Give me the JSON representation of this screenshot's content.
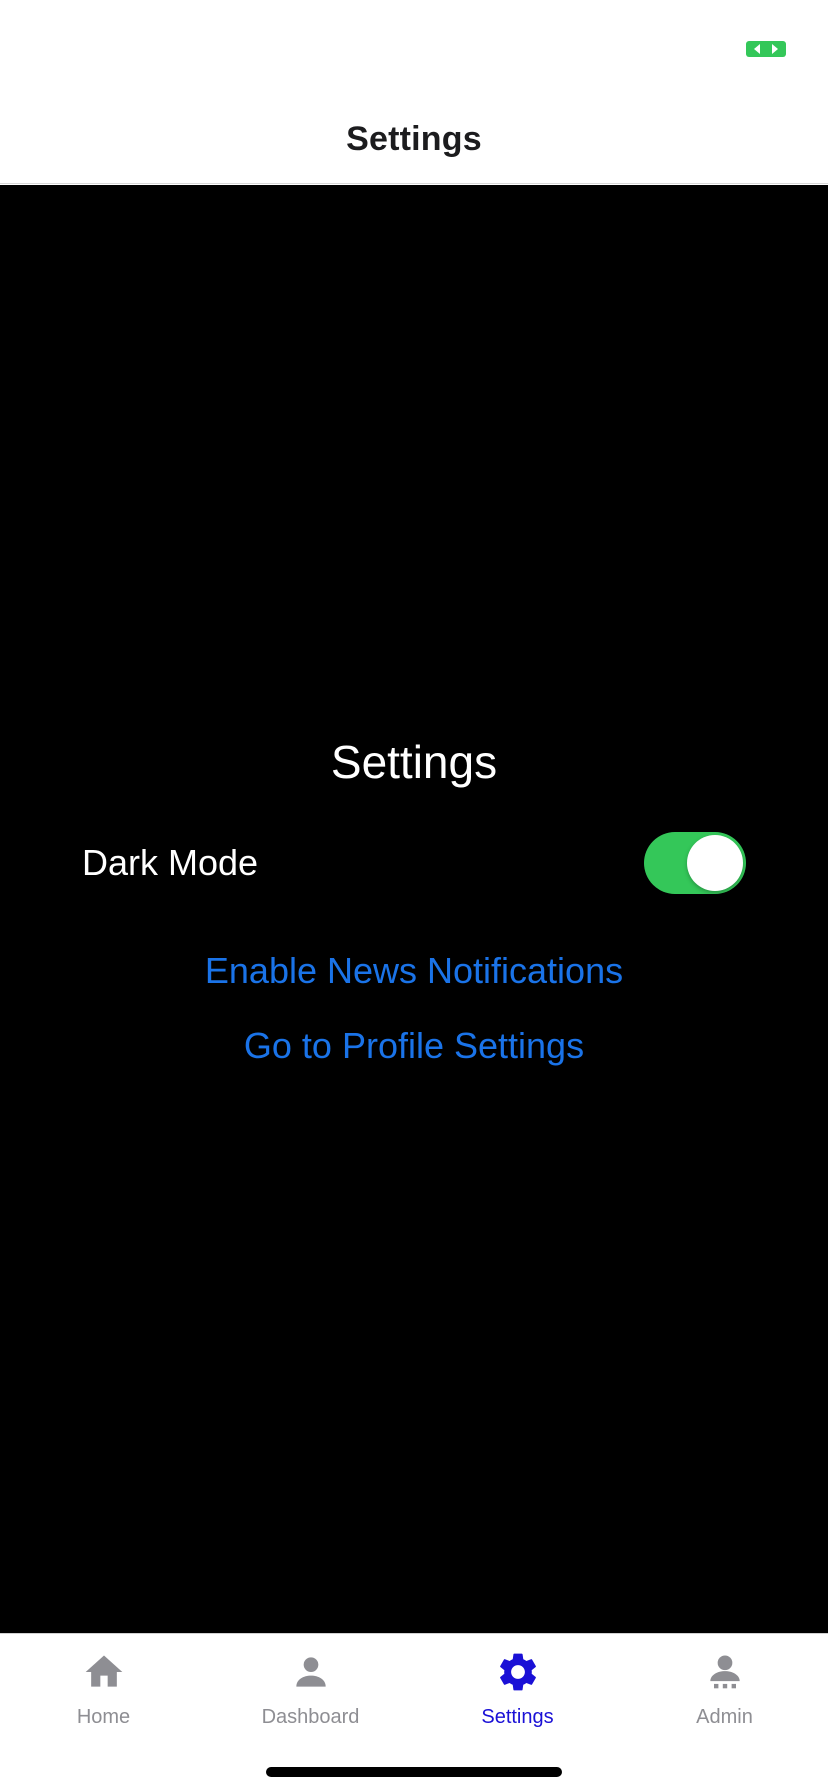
{
  "colors": {
    "accent": "#1a10d6",
    "link": "#1a73e8",
    "toggle_on": "#34c759",
    "status_indicator": "#34c759",
    "tab_inactive": "#8e8e93",
    "content_background": "#000000"
  },
  "header": {
    "title": "Settings"
  },
  "screen": {
    "title": "Settings",
    "dark_mode": {
      "label": "Dark Mode",
      "enabled": true
    },
    "links": {
      "news_notifications": "Enable News Notifications",
      "profile_settings": "Go to Profile Settings"
    }
  },
  "tabs": [
    {
      "label": "Home",
      "icon": "home-icon",
      "active": false
    },
    {
      "label": "Dashboard",
      "icon": "person-icon",
      "active": false
    },
    {
      "label": "Settings",
      "icon": "gear-icon",
      "active": true
    },
    {
      "label": "Admin",
      "icon": "admin-icon",
      "active": false
    }
  ]
}
